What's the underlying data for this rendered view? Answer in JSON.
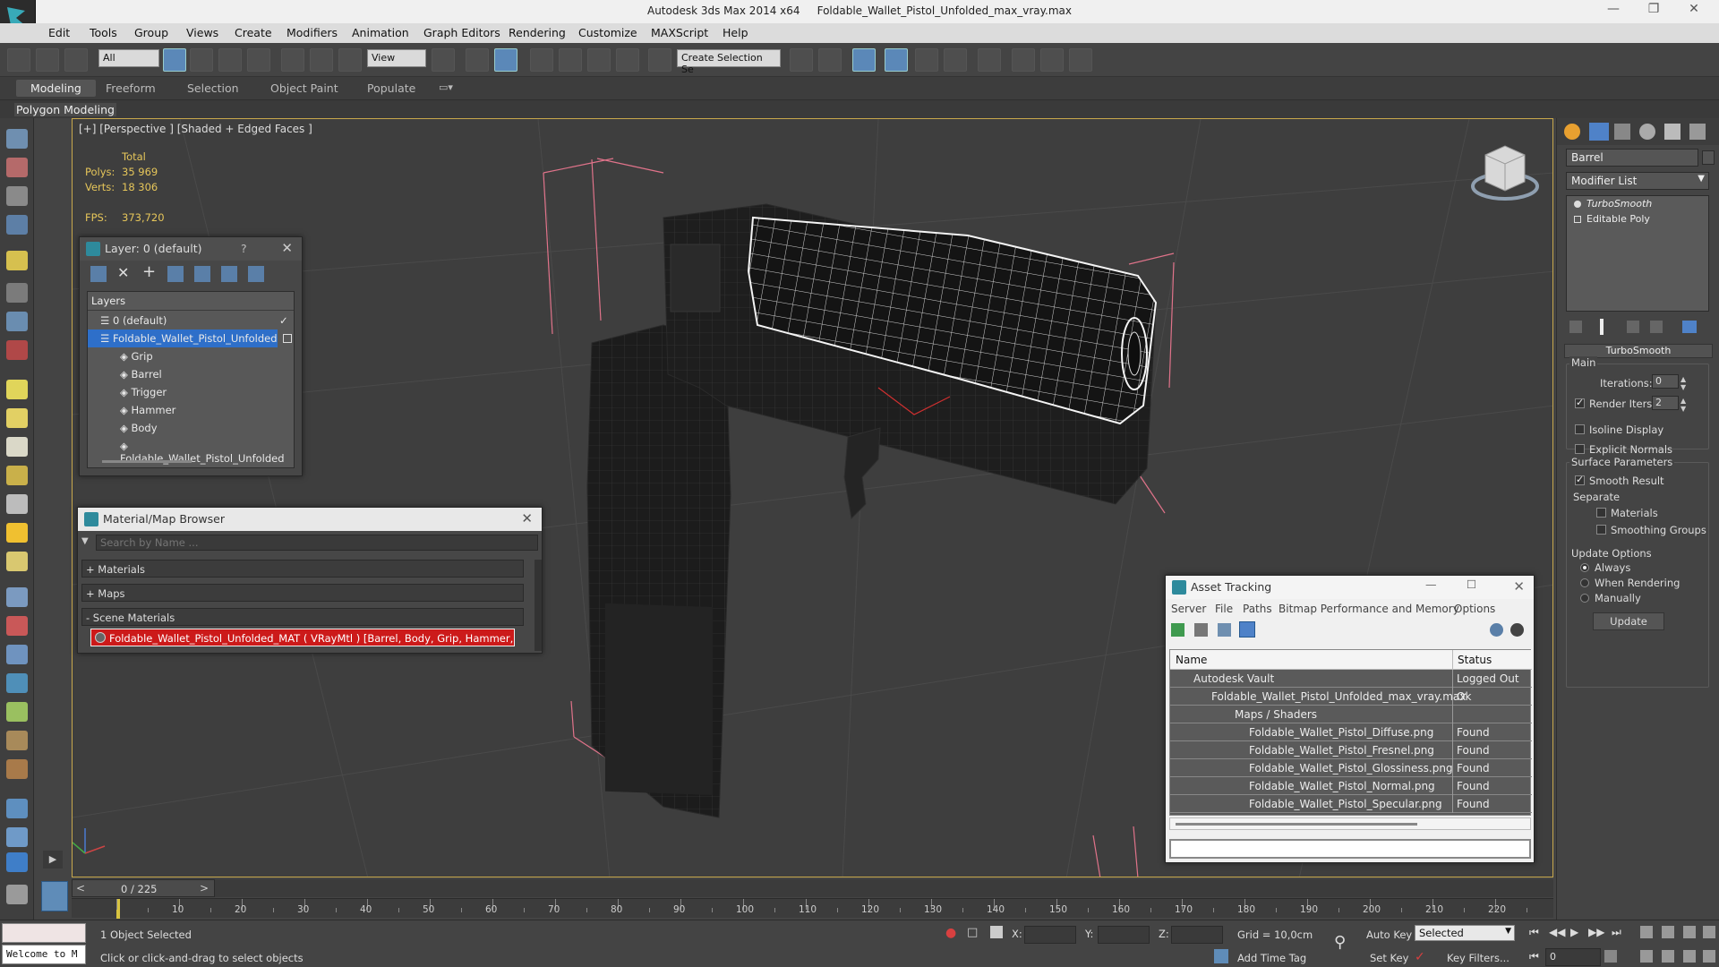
{
  "window": {
    "app": "Autodesk 3ds Max  2014 x64",
    "file": "Foldable_Wallet_Pistol_Unfolded_max_vray.max"
  },
  "menu": [
    "Edit",
    "Tools",
    "Group",
    "Views",
    "Create",
    "Modifiers",
    "Animation",
    "Graph Editors",
    "Rendering",
    "Customize",
    "MAXScript",
    "Help"
  ],
  "toolbar": {
    "selection_filter": "All",
    "ref_coord": "View",
    "named_selection": "Create Selection Se"
  },
  "ribbon": {
    "tabs": [
      "Modeling",
      "Freeform",
      "Selection",
      "Object Paint",
      "Populate"
    ],
    "active_tab": "Modeling",
    "panel_label": "Polygon Modeling"
  },
  "viewport": {
    "label": "[+] [Perspective ] [Shaded + Edged Faces ]",
    "stats": {
      "total_label": "Total",
      "polys_label": "Polys:",
      "polys": "35 969",
      "verts_label": "Verts:",
      "verts": "18 306",
      "fps_label": "FPS:",
      "fps": "373,720"
    }
  },
  "layer_window": {
    "title": "Layer: 0 (default)",
    "help": "?",
    "header": "Layers",
    "rows": [
      {
        "label": "0 (default)",
        "level": 0
      },
      {
        "label": "Foldable_Wallet_Pistol_Unfolded",
        "level": 0,
        "selected": true
      },
      {
        "label": "Grip",
        "level": 1
      },
      {
        "label": "Barrel",
        "level": 1
      },
      {
        "label": "Trigger",
        "level": 1
      },
      {
        "label": "Hammer",
        "level": 1
      },
      {
        "label": "Body",
        "level": 1
      },
      {
        "label": "Foldable_Wallet_Pistol_Unfolded",
        "level": 1
      }
    ]
  },
  "material_browser": {
    "title": "Material/Map Browser",
    "search_placeholder": "Search by Name ...",
    "sections": [
      "+ Materials",
      "+ Maps",
      "- Scene Materials"
    ],
    "scene_material": "Foldable_Wallet_Pistol_Unfolded_MAT ( VRayMtl ) [Barrel, Body, Grip, Hammer, Trigger]"
  },
  "asset_tracking": {
    "title": "Asset Tracking",
    "menu": [
      "Server",
      "File",
      "Paths",
      "Bitmap Performance and Memory",
      "Options"
    ],
    "columns": [
      "Name",
      "Status"
    ],
    "rows": [
      {
        "name": "Autodesk Vault",
        "status": "Logged Out ...",
        "indent": 0
      },
      {
        "name": "Foldable_Wallet_Pistol_Unfolded_max_vray.max",
        "status": "Ok",
        "indent": 1
      },
      {
        "name": "Maps / Shaders",
        "status": "",
        "indent": 2
      },
      {
        "name": "Foldable_Wallet_Pistol_Diffuse.png",
        "status": "Found",
        "indent": 3
      },
      {
        "name": "Foldable_Wallet_Pistol_Fresnel.png",
        "status": "Found",
        "indent": 3
      },
      {
        "name": "Foldable_Wallet_Pistol_Glossiness.png",
        "status": "Found",
        "indent": 3
      },
      {
        "name": "Foldable_Wallet_Pistol_Normal.png",
        "status": "Found",
        "indent": 3
      },
      {
        "name": "Foldable_Wallet_Pistol_Specular.png",
        "status": "Found",
        "indent": 3
      }
    ]
  },
  "command_panel": {
    "object_name": "Barrel",
    "modifier_list": "Modifier List",
    "stack": [
      "TurboSmooth",
      "Editable Poly"
    ],
    "rollout": "TurboSmooth",
    "main_label": "Main",
    "iterations_label": "Iterations:",
    "iterations": "0",
    "render_iters_label": "Render Iters:",
    "render_iters": "2",
    "isoline_display": "Isoline Display",
    "explicit_normals": "Explicit Normals",
    "surface_params": "Surface Parameters",
    "smooth_result": "Smooth Result",
    "separate": "Separate",
    "materials": "Materials",
    "smoothing_groups": "Smoothing Groups",
    "update_options": "Update Options",
    "always": "Always",
    "when_rendering": "When Rendering",
    "manually": "Manually",
    "update_button": "Update"
  },
  "timeline": {
    "frame": "0 / 225",
    "ticks": [
      "10",
      "20",
      "30",
      "40",
      "50",
      "60",
      "70",
      "80",
      "90",
      "100",
      "110",
      "120",
      "130",
      "140",
      "150",
      "160",
      "170",
      "180",
      "190",
      "200",
      "210",
      "220"
    ]
  },
  "status": {
    "maxscript": "Welcome to M",
    "selection": "1 Object Selected",
    "prompt": "Click or click-and-drag to select objects",
    "x_label": "X:",
    "y_label": "Y:",
    "z_label": "Z:",
    "grid": "Grid = 10,0cm",
    "auto_key": "Auto Key",
    "key_mode": "Selected",
    "set_key": "Set Key",
    "key_filters": "Key Filters...",
    "add_time_tag": "Add Time Tag",
    "frame_field": "0"
  }
}
